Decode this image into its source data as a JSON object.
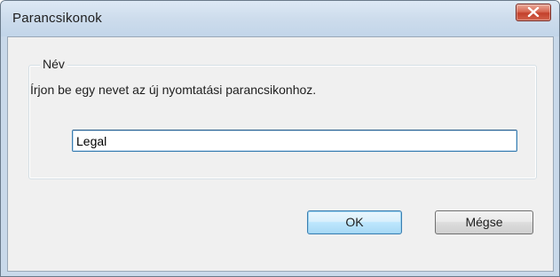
{
  "window": {
    "title": "Parancsikonok"
  },
  "group": {
    "legend": "Név",
    "prompt": "Írjon be egy nevet az új nyomtatási parancsikonhoz."
  },
  "name_field": {
    "value": "Legal"
  },
  "buttons": {
    "ok": "OK",
    "cancel": "Mégse"
  },
  "icons": {
    "close": "close-icon"
  },
  "colors": {
    "titlebar": "#cddcec",
    "close_button": "#c3402b",
    "client_background": "#f0f0f0",
    "focus_border": "#3c7fb1"
  }
}
